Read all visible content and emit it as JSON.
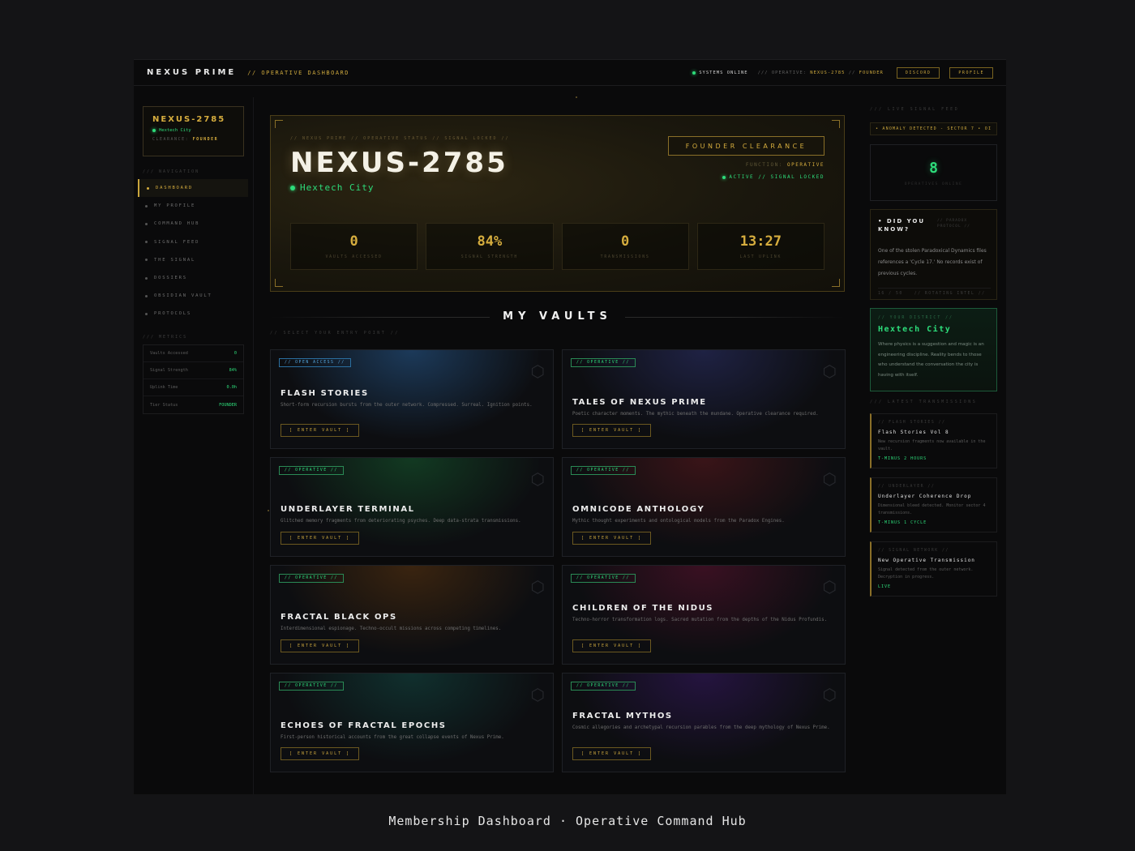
{
  "topbar": {
    "brand": "NEXUS PRIME",
    "subtitle": "// OPERATIVE DASHBOARD",
    "status": "SYSTEMS ONLINE",
    "operative_prefix": "/// OPERATIVE:",
    "operative_id": "NEXUS-2785",
    "operative_sep": "//",
    "tier": "FOUNDER",
    "discord_label": "DISCORD",
    "profile_label": "PROFILE"
  },
  "sidebar": {
    "id_name": "NEXUS-2785",
    "id_city": "Hextech City",
    "clearance_label": "CLEARANCE:",
    "clearance_value": "FOUNDER",
    "nav_label": "/// NAVIGATION",
    "nav": [
      {
        "label": "DASHBOARD",
        "active": true
      },
      {
        "label": "MY PROFILE"
      },
      {
        "label": "COMMAND HUB"
      },
      {
        "label": "SIGNAL FEED"
      },
      {
        "label": "THE SIGNAL"
      },
      {
        "label": "DOSSIERS"
      },
      {
        "label": "OBSIDIAN VAULT"
      },
      {
        "label": "PROTOCOLS"
      }
    ],
    "metrics_label": "/// METRICS",
    "metrics": [
      {
        "label": "Vaults Accessed",
        "value": "0"
      },
      {
        "label": "Signal Strength",
        "value": "84%"
      },
      {
        "label": "Uplink Time",
        "value": "0.0h"
      },
      {
        "label": "Tier Status",
        "value": "FOUNDER"
      }
    ]
  },
  "hero": {
    "crumb": "// NEXUS PRIME // OPERATIVE STATUS // SIGNAL LOCKED //",
    "name": "NEXUS-2785",
    "location": "Hextech City",
    "clearance": "FOUNDER CLEARANCE",
    "function_label": "FUNCTION:",
    "function_value": "OPERATIVE",
    "active": "ACTIVE // SIGNAL LOCKED",
    "stats": [
      {
        "value": "0",
        "label": "VAULTS ACCESSED"
      },
      {
        "value": "84%",
        "label": "SIGNAL STRENGTH"
      },
      {
        "value": "0",
        "label": "TRANSMISSIONS"
      },
      {
        "value": "13:27",
        "label": "LAST UPLINK"
      }
    ]
  },
  "vaults": {
    "title": "MY VAULTS",
    "subtitle": "// SELECT YOUR ENTRY POINT //",
    "enter_label": "[ ENTER VAULT ]",
    "items": [
      {
        "tag": "// OPEN ACCESS //",
        "title": "FLASH STORIES",
        "desc": "Short-form recursion bursts from the outer network. Compressed. Surreal. Ignition points.",
        "accent": "#1c3a5a"
      },
      {
        "tag": "// OPERATIVE //",
        "title": "TALES OF NEXUS PRIME",
        "desc": "Poetic character moments. The mythic beneath the mundane. Operative clearance required.",
        "accent": "#1f2244"
      },
      {
        "tag": "// OPERATIVE //",
        "title": "UNDERLAYER TERMINAL",
        "desc": "Glitched memory fragments from deteriorating psyches. Deep data-strata transmissions.",
        "accent": "#123a22"
      },
      {
        "tag": "// OPERATIVE //",
        "title": "OMNICODE ANTHOLOGY",
        "desc": "Mythic thought experiments and ontological models from the Paradox Engines.",
        "accent": "#3a1418"
      },
      {
        "tag": "// OPERATIVE //",
        "title": "FRACTAL BLACK OPS",
        "desc": "Interdimensional espionage. Techno-occult missions across competing timelines.",
        "accent": "#3a2410"
      },
      {
        "tag": "// OPERATIVE //",
        "title": "CHILDREN OF THE NIDUS",
        "desc": "Techno-horror transformation logs. Sacred mutation from the depths of the Nidus Profundis.",
        "accent": "#3a1022"
      },
      {
        "tag": "// OPERATIVE //",
        "title": "ECHOES OF FRACTAL EPOCHS",
        "desc": "First-person historical accounts from the great collapse events of Nexus Prime.",
        "accent": "#10302e"
      },
      {
        "tag": "// OPERATIVE //",
        "title": "FRACTAL MYTHOS",
        "desc": "Cosmic allegories and archetypal recursion parables from the deep mythology of Nexus Prime.",
        "accent": "#251440"
      }
    ]
  },
  "right": {
    "feed_label": "/// LIVE SIGNAL FEED",
    "ticker": "ANOMALY DETECTED - SECTOR 7  •  OI",
    "online_count": "8",
    "online_label": "OPERATIVES ONLINE",
    "dyk_title": "DID YOU KNOW?",
    "dyk_tag": "// PARADOX PROTOCOL //",
    "dyk_body": "One of the stolen Paradoxical Dynamics files references a 'Cycle 17.' No records exist of previous cycles.",
    "dyk_page": "16 / 50",
    "dyk_rot": "// ROTATING INTEL //",
    "district_label": "// YOUR DISTRICT //",
    "district_city": "Hextech City",
    "district_desc": "Where physics is a suggestion and magic is an engineering discipline. Reality bends to those who understand the conversation the city is having with itself.",
    "latest_label": "/// LATEST TRANSMISSIONS",
    "transmissions": [
      {
        "src": "// FLASH STORIES //",
        "title": "Flash Stories Vol 8",
        "desc": "New recursion fragments now available in the vault.",
        "meta": "T-MINUS 2 HOURS"
      },
      {
        "src": "// UNDERLAYER //",
        "title": "Underlayer Coherence Drop",
        "desc": "Dimensional bleed detected. Monitor sector 4 transmissions.",
        "meta": "T-MINUS 1 CYCLE"
      },
      {
        "src": "// SIGNAL NETWORK //",
        "title": "New Operative Transmission",
        "desc": "Signal detected from the outer network. Decryption in progress.",
        "meta": "LIVE"
      }
    ]
  },
  "caption": "Membership Dashboard · Operative Command Hub"
}
